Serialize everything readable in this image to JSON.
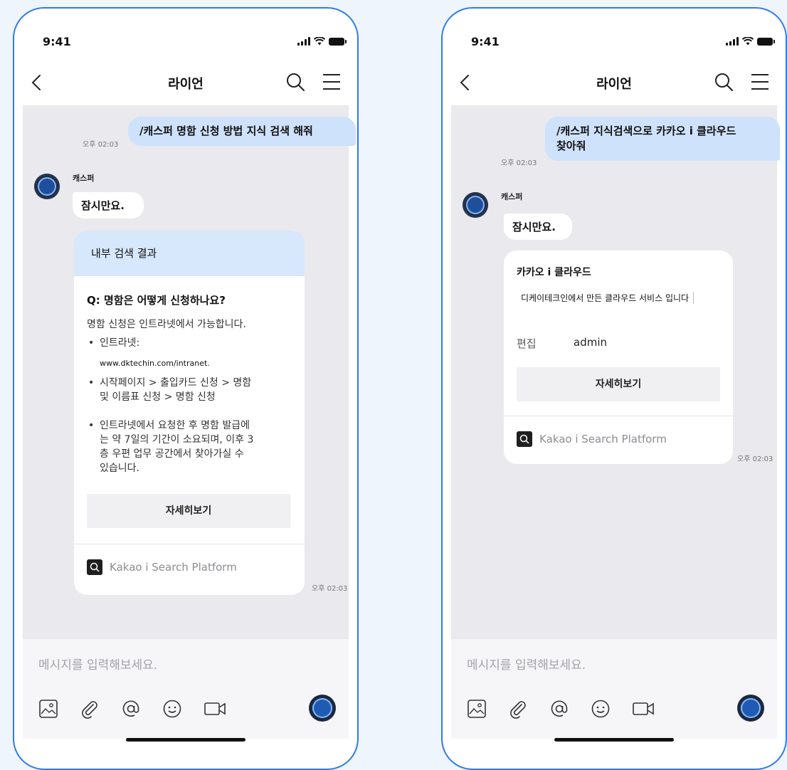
{
  "phones": [
    {
      "status": {
        "time": "9:41"
      },
      "header": {
        "title": "라이언"
      },
      "user_message": {
        "text": "/캐스퍼 명함 신청 방법 지식 검색 해줘",
        "time": "오후 02:03"
      },
      "bot": {
        "sender": "캐스퍼",
        "reply": "잠시만요.",
        "card": {
          "header": "내부 검색 결과",
          "question": "Q: 명함은 어떻게 신청하나요?",
          "answer": "명함 신청은 인트라넷에서 가능합니다.",
          "bullet1": "인트라넷:",
          "url": "www.dktechin.com/intranet.",
          "bullet2_line1": "시작페이지 > 출입카드 신청 > 명함",
          "bullet2_line2": "및 이름표 신청 > 명함 신청",
          "bullet3_line1": "인트라넷에서 요청한 후 명함 발급에",
          "bullet3_line2": "는 약 7일의 기간이 소요되며, 이후 3",
          "bullet3_line3": "층 우편 업무 공간에서 찾아가실 수",
          "bullet3_line4": "있습니다.",
          "detail_button": "자세히보기",
          "footer": "Kakao i Search Platform"
        },
        "time": "오후 02:03"
      },
      "input": {
        "placeholder": "메시지를 입력해보세요."
      }
    },
    {
      "status": {
        "time": "9:41"
      },
      "header": {
        "title": "라이언"
      },
      "user_message": {
        "line1": "/캐스퍼 지식검색으로 카카오 i 클라우드",
        "line2": "찾아줘",
        "time": "오후 02:03"
      },
      "bot": {
        "sender": "캐스퍼",
        "reply": "잠시만요.",
        "card": {
          "title": "카카오 i 클라우드",
          "description": "디케이테크인에서 만든 클라우드 서비스 입니다",
          "meta_key": "편집",
          "meta_value": "admin",
          "detail_button": "자세히보기",
          "footer": "Kakao i Search Platform"
        },
        "time": "오후 02:03"
      },
      "input": {
        "placeholder": "메시지를 입력해보세요."
      }
    }
  ],
  "icons": [
    "chevron-left-icon",
    "search-icon",
    "menu-icon",
    "image-icon",
    "attach-icon",
    "mention-icon",
    "emoji-icon",
    "video-icon"
  ],
  "colors": {
    "frame": "#2f7ce8",
    "user_bubble": "#cfe2fb",
    "card_header": "#d7e7fc",
    "chat_bg": "#e9e9ee"
  }
}
